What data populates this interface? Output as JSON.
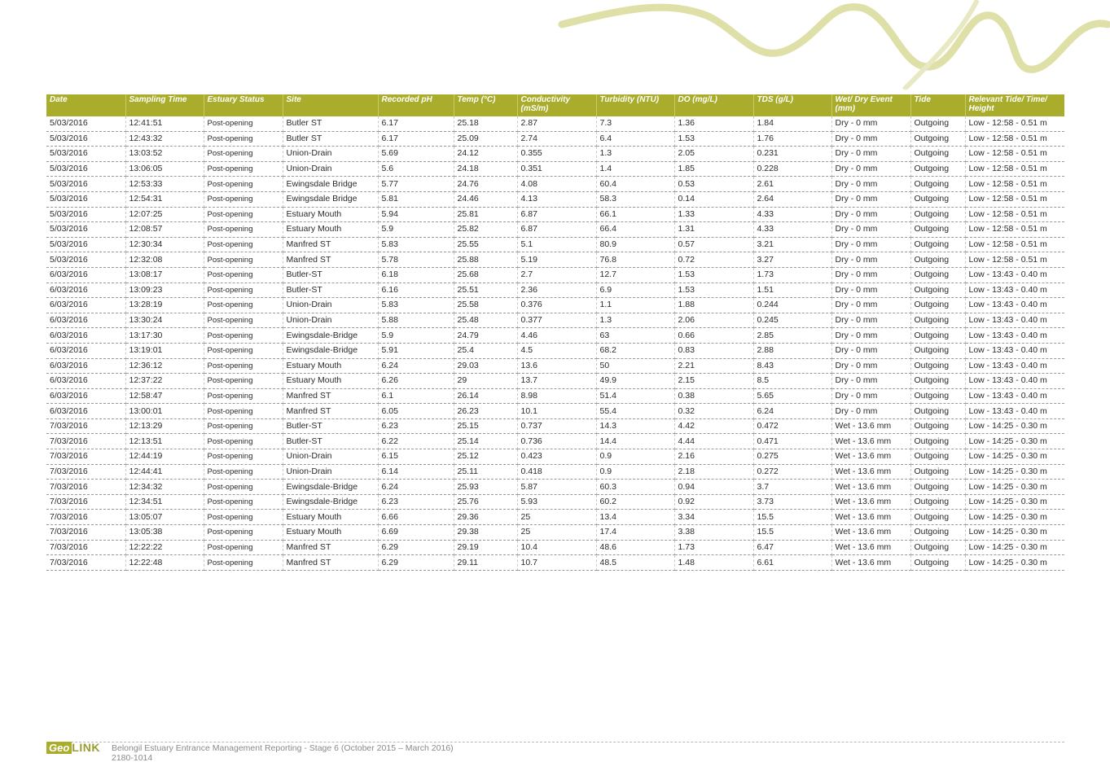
{
  "colors": {
    "accent": "#a9ad2b",
    "header_text": "#ffffff"
  },
  "table": {
    "headers": [
      "Date",
      "Sampling Time",
      "Estuary Status",
      "Site",
      "Recorded pH",
      "Temp (°C)",
      "Conductivity (mS/m)",
      "Turbidity (NTU)",
      "DO (mg/L)",
      "TDS (g/L)",
      "Wet/ Dry Event (mm)",
      "Tide",
      "Relevant Tide/ Time/ Height"
    ],
    "rows": [
      [
        "5/03/2016",
        "12:41:51",
        "Post-opening",
        "Butler ST",
        "6.17",
        "25.18",
        "2.87",
        "7.3",
        "1.36",
        "1.84",
        "Dry - 0 mm",
        "Outgoing",
        "Low - 12:58 - 0.51 m"
      ],
      [
        "5/03/2016",
        "12:43:32",
        "Post-opening",
        "Butler ST",
        "6.17",
        "25.09",
        "2.74",
        "6.4",
        "1.53",
        "1.76",
        "Dry - 0 mm",
        "Outgoing",
        "Low - 12:58 - 0.51 m"
      ],
      [
        "5/03/2016",
        "13:03:52",
        "Post-opening",
        "Union-Drain",
        "5.69",
        "24.12",
        "0.355",
        "1.3",
        "2.05",
        "0.231",
        "Dry - 0 mm",
        "Outgoing",
        "Low - 12:58 - 0.51 m"
      ],
      [
        "5/03/2016",
        "13:06:05",
        "Post-opening",
        "Union-Drain",
        "5.6",
        "24.18",
        "0.351",
        "1.4",
        "1.85",
        "0.228",
        "Dry - 0 mm",
        "Outgoing",
        "Low - 12:58 - 0.51 m"
      ],
      [
        "5/03/2016",
        "12:53:33",
        "Post-opening",
        "Ewingsdale Bridge",
        "5.77",
        "24.76",
        "4.08",
        "60.4",
        "0.53",
        "2.61",
        "Dry - 0 mm",
        "Outgoing",
        "Low - 12:58 - 0.51 m"
      ],
      [
        "5/03/2016",
        "12:54:31",
        "Post-opening",
        "Ewingsdale Bridge",
        "5.81",
        "24.46",
        "4.13",
        "58.3",
        "0.14",
        "2.64",
        "Dry - 0 mm",
        "Outgoing",
        "Low - 12:58 - 0.51 m"
      ],
      [
        "5/03/2016",
        "12:07:25",
        "Post-opening",
        "Estuary Mouth",
        "5.94",
        "25.81",
        "6.87",
        "66.1",
        "1.33",
        "4.33",
        "Dry - 0 mm",
        "Outgoing",
        "Low - 12:58 - 0.51 m"
      ],
      [
        "5/03/2016",
        "12:08:57",
        "Post-opening",
        "Estuary Mouth",
        "5.9",
        "25.82",
        "6.87",
        "66.4",
        "1.31",
        "4.33",
        "Dry - 0 mm",
        "Outgoing",
        "Low - 12:58 - 0.51 m"
      ],
      [
        "5/03/2016",
        "12:30:34",
        "Post-opening",
        "Manfred ST",
        "5.83",
        "25.55",
        "5.1",
        "80.9",
        "0.57",
        "3.21",
        "Dry - 0 mm",
        "Outgoing",
        "Low - 12:58 - 0.51 m"
      ],
      [
        "5/03/2016",
        "12:32:08",
        "Post-opening",
        "Manfred ST",
        "5.78",
        "25.88",
        "5.19",
        "76.8",
        "0.72",
        "3.27",
        "Dry - 0 mm",
        "Outgoing",
        "Low - 12:58 - 0.51 m"
      ],
      [
        "6/03/2016",
        "13:08:17",
        "Post-opening",
        "Butler-ST",
        "6.18",
        "25.68",
        "2.7",
        "12.7",
        "1.53",
        "1.73",
        "Dry - 0 mm",
        "Outgoing",
        "Low - 13:43 - 0.40 m"
      ],
      [
        "6/03/2016",
        "13:09:23",
        "Post-opening",
        "Butler-ST",
        "6.16",
        "25.51",
        "2.36",
        "6.9",
        "1.53",
        "1.51",
        "Dry - 0 mm",
        "Outgoing",
        "Low - 13:43 - 0.40 m"
      ],
      [
        "6/03/2016",
        "13:28:19",
        "Post-opening",
        "Union-Drain",
        "5.83",
        "25.58",
        "0.376",
        "1.1",
        "1.88",
        "0.244",
        "Dry - 0 mm",
        "Outgoing",
        "Low - 13:43 - 0.40 m"
      ],
      [
        "6/03/2016",
        "13:30:24",
        "Post-opening",
        "Union-Drain",
        "5.88",
        "25.48",
        "0.377",
        "1.3",
        "2.06",
        "0.245",
        "Dry - 0 mm",
        "Outgoing",
        "Low - 13:43 - 0.40 m"
      ],
      [
        "6/03/2016",
        "13:17:30",
        "Post-opening",
        "Ewingsdale-Bridge",
        "5.9",
        "24.79",
        "4.46",
        "63",
        "0.66",
        "2.85",
        "Dry - 0 mm",
        "Outgoing",
        "Low - 13:43 - 0.40 m"
      ],
      [
        "6/03/2016",
        "13:19:01",
        "Post-opening",
        "Ewingsdale-Bridge",
        "5.91",
        "25.4",
        "4.5",
        "68.2",
        "0.83",
        "2.88",
        "Dry - 0 mm",
        "Outgoing",
        "Low - 13:43 - 0.40 m"
      ],
      [
        "6/03/2016",
        "12:36:12",
        "Post-opening",
        "Estuary Mouth",
        "6.24",
        "29.03",
        "13.6",
        "50",
        "2.21",
        "8.43",
        "Dry - 0 mm",
        "Outgoing",
        "Low - 13:43 - 0.40 m"
      ],
      [
        "6/03/2016",
        "12:37:22",
        "Post-opening",
        "Estuary Mouth",
        "6.26",
        "29",
        "13.7",
        "49.9",
        "2.15",
        "8.5",
        "Dry - 0 mm",
        "Outgoing",
        "Low - 13:43 - 0.40 m"
      ],
      [
        "6/03/2016",
        "12:58:47",
        "Post-opening",
        "Manfred ST",
        "6.1",
        "26.14",
        "8.98",
        "51.4",
        "0.38",
        "5.65",
        "Dry - 0 mm",
        "Outgoing",
        "Low - 13:43 - 0.40 m"
      ],
      [
        "6/03/2016",
        "13:00:01",
        "Post-opening",
        "Manfred ST",
        "6.05",
        "26.23",
        "10.1",
        "55.4",
        "0.32",
        "6.24",
        "Dry - 0 mm",
        "Outgoing",
        "Low - 13:43 - 0.40 m"
      ],
      [
        "7/03/2016",
        "12:13:29",
        "Post-opening",
        "Butler-ST",
        "6.23",
        "25.15",
        "0.737",
        "14.3",
        "4.42",
        "0.472",
        "Wet - 13.6 mm",
        "Outgoing",
        "Low - 14:25 - 0.30 m"
      ],
      [
        "7/03/2016",
        "12:13:51",
        "Post-opening",
        "Butler-ST",
        "6.22",
        "25.14",
        "0.736",
        "14.4",
        "4.44",
        "0.471",
        "Wet - 13.6 mm",
        "Outgoing",
        "Low - 14:25 - 0.30 m"
      ],
      [
        "7/03/2016",
        "12:44:19",
        "Post-opening",
        "Union-Drain",
        "6.15",
        "25.12",
        "0.423",
        "0.9",
        "2.16",
        "0.275",
        "Wet - 13.6 mm",
        "Outgoing",
        "Low - 14:25 - 0.30 m"
      ],
      [
        "7/03/2016",
        "12:44:41",
        "Post-opening",
        "Union-Drain",
        "6.14",
        "25.11",
        "0.418",
        "0.9",
        "2.18",
        "0.272",
        "Wet - 13.6 mm",
        "Outgoing",
        "Low - 14:25 - 0.30 m"
      ],
      [
        "7/03/2016",
        "12:34:32",
        "Post-opening",
        "Ewingsdale-Bridge",
        "6.24",
        "25.93",
        "5.87",
        "60.3",
        "0.94",
        "3.7",
        "Wet - 13.6 mm",
        "Outgoing",
        "Low - 14:25 - 0.30 m"
      ],
      [
        "7/03/2016",
        "12:34:51",
        "Post-opening",
        "Ewingsdale-Bridge",
        "6.23",
        "25.76",
        "5.93",
        "60.2",
        "0.92",
        "3.73",
        "Wet - 13.6 mm",
        "Outgoing",
        "Low - 14:25 - 0.30 m"
      ],
      [
        "7/03/2016",
        "13:05:07",
        "Post-opening",
        "Estuary Mouth",
        "6.66",
        "29.36",
        "25",
        "13.4",
        "3.34",
        "15.5",
        "Wet - 13.6 mm",
        "Outgoing",
        "Low - 14:25 - 0.30 m"
      ],
      [
        "7/03/2016",
        "13:05:38",
        "Post-opening",
        "Estuary Mouth",
        "6.69",
        "29.38",
        "25",
        "17.4",
        "3.38",
        "15.5",
        "Wet - 13.6 mm",
        "Outgoing",
        "Low - 14:25 - 0.30 m"
      ],
      [
        "7/03/2016",
        "12:22:22",
        "Post-opening",
        "Manfred ST",
        "6.29",
        "29.19",
        "10.4",
        "48.6",
        "1.73",
        "6.47",
        "Wet - 13.6 mm",
        "Outgoing",
        "Low - 14:25 - 0.30 m"
      ],
      [
        "7/03/2016",
        "12:22:48",
        "Post-opening",
        "Manfred ST",
        "6.29",
        "29.11",
        "10.7",
        "48.5",
        "1.48",
        "6.61",
        "Wet - 13.6 mm",
        "Outgoing",
        "Low - 14:25 - 0.30 m"
      ]
    ]
  },
  "footer": {
    "logo_geo": "Geo",
    "logo_link": "LINK",
    "line1": "Belongil Estuary Entrance Management Reporting - Stage 6 (October 2015 – March 2016)",
    "line2": "2180-1014"
  }
}
